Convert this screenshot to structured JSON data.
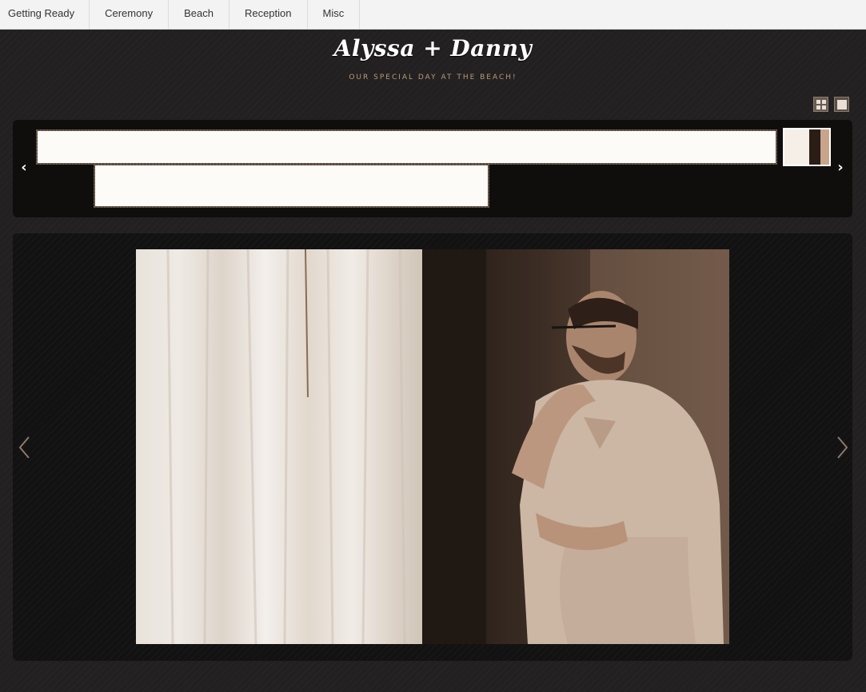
{
  "nav": {
    "tabs": [
      {
        "label": "Getting Ready"
      },
      {
        "label": "Ceremony"
      },
      {
        "label": "Beach"
      },
      {
        "label": "Reception"
      },
      {
        "label": "Misc"
      }
    ]
  },
  "header": {
    "title": "Alyssa + Danny",
    "subtitle": "OUR SPECIAL DAY AT THE BEACH!"
  },
  "view_toggle": {
    "options": [
      {
        "icon": "grid-view-icon"
      },
      {
        "icon": "single-view-icon"
      }
    ]
  },
  "filmstrip": {
    "prev_icon": "chevron-left-icon",
    "next_icon": "chevron-right-icon",
    "prev_glyph": "‹",
    "next_glyph": "›"
  },
  "viewer": {
    "prev_icon": "chevron-left-icon",
    "next_icon": "chevron-right-icon",
    "photo_description_icon": "photo"
  },
  "colors": {
    "background": "#222020",
    "nav_bg": "#f3f3f3",
    "subtitle": "#b79a7c",
    "title": "#ffffff"
  }
}
